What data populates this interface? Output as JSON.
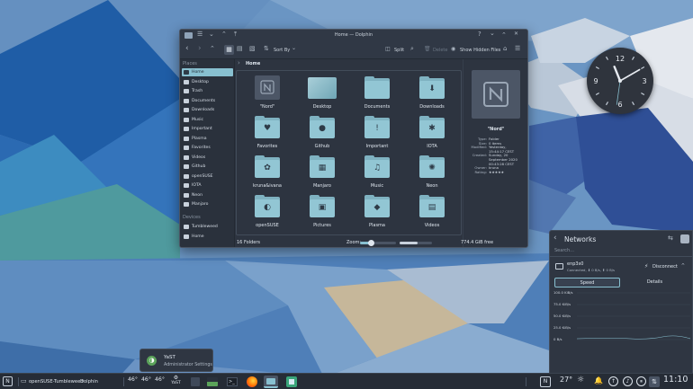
{
  "window": {
    "title": "Home — Dolphin",
    "controls": {
      "help": "?",
      "minimize": "⌄",
      "maximize": "⌃",
      "close": "✕"
    },
    "toolbar": {
      "sort_label": "Sort By",
      "split_label": "Split",
      "delete_label": "Delete",
      "hidden_label": "Show Hidden Files"
    },
    "breadcrumb": {
      "sep": "›",
      "current": "Home"
    }
  },
  "sidebar": {
    "places_header": "Places",
    "places": [
      {
        "label": "Home",
        "selected": true,
        "icon": "home-icon"
      },
      {
        "label": "Desktop",
        "icon": "desktop-icon"
      },
      {
        "label": "Trash",
        "icon": "trash-icon"
      },
      {
        "label": "Documents",
        "icon": "documents-icon"
      },
      {
        "label": "Downloads",
        "icon": "downloads-icon"
      },
      {
        "label": "Music",
        "icon": "music-icon"
      },
      {
        "label": "Important",
        "icon": "important-icon"
      },
      {
        "label": "Plasma",
        "icon": "plasma-icon"
      },
      {
        "label": "Favorites",
        "icon": "heart-icon"
      },
      {
        "label": "Videos",
        "icon": "videos-icon"
      },
      {
        "label": "Github",
        "icon": "github-icon"
      },
      {
        "label": "openSUSE",
        "icon": "opensuse-icon"
      },
      {
        "label": "IOTA",
        "icon": "iota-icon"
      },
      {
        "label": "Neon",
        "icon": "neon-icon"
      },
      {
        "label": "Manjaro",
        "icon": "manjaro-icon"
      }
    ],
    "devices_header": "Devices",
    "devices": [
      {
        "label": "Tumbleweed",
        "icon": "drive-icon"
      },
      {
        "label": "Home",
        "icon": "drive-icon"
      }
    ]
  },
  "files": [
    {
      "label": "\"Nord\"",
      "icon": "nord-logo-icon",
      "sym": ""
    },
    {
      "label": "Desktop",
      "icon": "desktop-folder-icon",
      "sym": ""
    },
    {
      "label": "Documents",
      "icon": "documents-folder-icon",
      "sym": ""
    },
    {
      "label": "Downloads",
      "icon": "downloads-folder-icon",
      "sym": "⬇"
    },
    {
      "label": "Favorites",
      "icon": "favorites-folder-icon",
      "sym": "♥"
    },
    {
      "label": "Github",
      "icon": "github-folder-icon",
      "sym": "●"
    },
    {
      "label": "Important",
      "icon": "important-folder-icon",
      "sym": "!"
    },
    {
      "label": "IOTA",
      "icon": "iota-folder-icon",
      "sym": "✱"
    },
    {
      "label": "kruna&ivana",
      "icon": "image-folder-icon",
      "sym": "✿"
    },
    {
      "label": "Manjaro",
      "icon": "manjaro-folder-icon",
      "sym": "▦"
    },
    {
      "label": "Music",
      "icon": "music-folder-icon",
      "sym": "♫"
    },
    {
      "label": "Neon",
      "icon": "neon-folder-icon",
      "sym": "✺"
    },
    {
      "label": "openSUSE",
      "icon": "opensuse-folder-icon",
      "sym": "◐"
    },
    {
      "label": "Pictures",
      "icon": "pictures-folder-icon",
      "sym": "▣"
    },
    {
      "label": "Plasma",
      "icon": "plasma-folder-icon",
      "sym": "◆"
    },
    {
      "label": "Videos",
      "icon": "videos-folder-icon",
      "sym": "▤"
    }
  ],
  "info": {
    "name": "\"Nord\"",
    "rows": [
      {
        "k": "Type:",
        "v": "Folder"
      },
      {
        "k": "Size:",
        "v": "0 items"
      },
      {
        "k": "Modified:",
        "v": "Yesterday,"
      },
      {
        "k": "",
        "v": "15:44:17 CEST"
      },
      {
        "k": "Created:",
        "v": "Sunday, 20"
      },
      {
        "k": "",
        "v": "September 2020"
      },
      {
        "k": "",
        "v": "00:43:28 CEST"
      },
      {
        "k": "Owner:",
        "v": "kruna"
      },
      {
        "k": "Rating:",
        "v": "★★★★★"
      }
    ]
  },
  "statusbar": {
    "count": "16 Folders",
    "zoom_label": "Zoom:",
    "free": "774.4 GiB free",
    "zoom_level": 0.3,
    "space_used": 0.55
  },
  "clock": {
    "numerals": [
      "12",
      "3",
      "6",
      "9"
    ],
    "hour_deg": 338,
    "minute_deg": 60,
    "second_deg": 188
  },
  "networks": {
    "title": "Networks",
    "search_placeholder": "Search...",
    "connection_name": "enp3s0",
    "connection_status": "Connected, ⬇ 0 B/s, ⬆ 0 B/s",
    "disconnect_label": "Disconnect",
    "tabs": [
      "Speed",
      "Details"
    ],
    "active_tab": "Speed",
    "chart_labels": [
      "100.0 KiB/s",
      "75.0 KiB/s",
      "50.0 KiB/s",
      "25.0 KiB/s",
      "0 B/s"
    ]
  },
  "yast": {
    "title": "YaST",
    "subtitle": "Administrator Settings"
  },
  "taskbar": {
    "distro": "openSUSE-Tumbleweed",
    "app": "Dolphin",
    "temps": [
      "46°",
      "46°",
      "46°"
    ],
    "yast_label": "YaST",
    "weather": "27°",
    "time": "11:10"
  },
  "colors": {
    "accent": "#88c0d0",
    "panel": "#2f3642",
    "folder": "#92c6d4"
  }
}
